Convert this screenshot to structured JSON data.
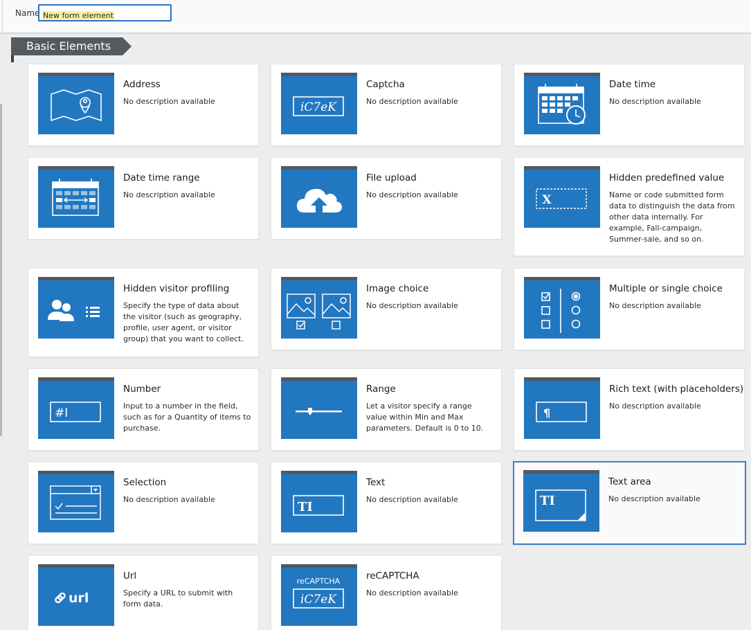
{
  "header": {
    "name_label": "Name",
    "name_value": "New form element"
  },
  "section": {
    "title": "Basic Elements"
  },
  "elements": [
    {
      "title": "Address",
      "description": "No description available",
      "icon": "map-pin-icon"
    },
    {
      "title": "Captcha",
      "description": "No description available",
      "icon": "captcha-icon"
    },
    {
      "title": "Date time",
      "description": "No description available",
      "icon": "calendar-clock-icon"
    },
    {
      "title": "Date time range",
      "description": "No description available",
      "icon": "calendar-range-icon"
    },
    {
      "title": "File upload",
      "description": "No description available",
      "icon": "cloud-upload-icon"
    },
    {
      "title": "Hidden predefined value",
      "description": "Name or code submitted form data to distinguish the data from other data internally. For example, Fall-campaign, Summer-sale, and so on.",
      "icon": "hidden-value-icon"
    },
    {
      "title": "Hidden visitor profiling",
      "description": "Specify the type of data about the visitor (such as geography, profile, user agent, or visitor group) that you want to collect.",
      "icon": "visitor-profile-icon"
    },
    {
      "title": "Image choice",
      "description": "No description available",
      "icon": "image-choice-icon"
    },
    {
      "title": "Multiple or single choice",
      "description": "No description available",
      "icon": "choice-icon"
    },
    {
      "title": "Number",
      "description": "Input to a number in the field, such as for a Quantity of items to purchase.",
      "icon": "number-field-icon"
    },
    {
      "title": "Range",
      "description": "Let a visitor specify a range value within Min and Max parameters. Default is 0 to 10.",
      "icon": "slider-icon"
    },
    {
      "title": "Rich text (with placeholders)",
      "description": "No description available",
      "icon": "pilcrow-field-icon"
    },
    {
      "title": "Selection",
      "description": "No description available",
      "icon": "dropdown-list-icon"
    },
    {
      "title": "Text",
      "description": "No description available",
      "icon": "text-field-icon"
    },
    {
      "title": "Text area",
      "description": "No description available",
      "icon": "text-area-icon",
      "selected": true
    },
    {
      "title": "Url",
      "description": "Specify a URL to submit with form data.",
      "icon": "url-icon"
    },
    {
      "title": "reCAPTCHA",
      "description": "No description available",
      "icon": "recaptcha-icon"
    }
  ],
  "icon_text": {
    "captcha": "iC7eK",
    "hidden": "X",
    "number": "#I",
    "pilcrow": "¶",
    "text": "TI",
    "url": "url",
    "recaptcha_label": "reCAPTCHA"
  },
  "colors": {
    "thumb_blue": "#2277c1",
    "thumb_bar": "#54585c",
    "selected_border": "#3f7fc9",
    "section_tab": "#555a5e"
  }
}
